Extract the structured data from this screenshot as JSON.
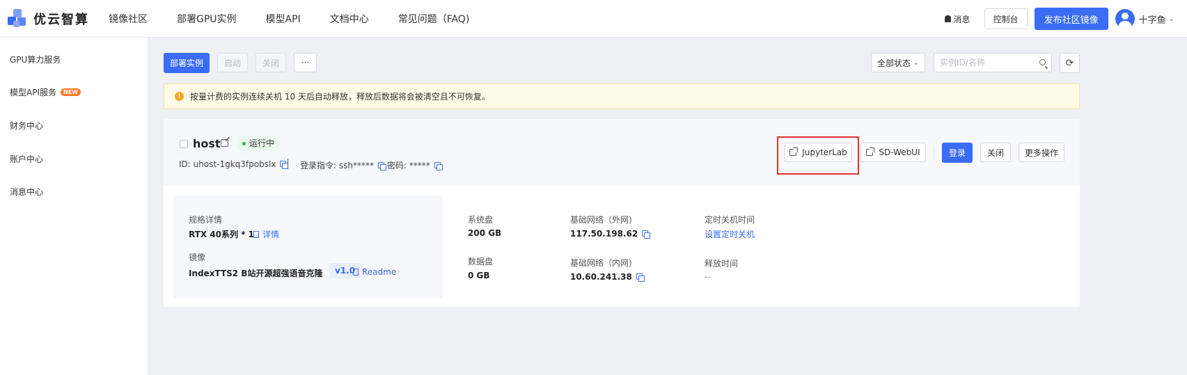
{
  "brand": {
    "name": "优云智算"
  },
  "nav": [
    "镜像社区",
    "部署GPU实例",
    "模型API",
    "文档中心",
    "常见问题（FAQ)"
  ],
  "header": {
    "messages": "消息",
    "console": "控制台",
    "publish": "发布社区镜像",
    "username": "十字鱼"
  },
  "sidebar": {
    "items": [
      {
        "label": "GPU算力服务"
      },
      {
        "label": "模型API服务",
        "badge": "NEW"
      },
      {
        "label": "财务中心"
      },
      {
        "label": "账户中心"
      },
      {
        "label": "消息中心"
      }
    ]
  },
  "toolbar": {
    "deploy": "部署实例",
    "start": "启动",
    "stop": "关闭",
    "more": "···",
    "status_filter": "全部状态",
    "search_placeholder": "实例ID/名称"
  },
  "notice": {
    "text": "按量计费的实例连续关机 10 天后自动释放，释放后数据将会被清空且不可恢复。"
  },
  "instance": {
    "name": "host",
    "status": "运行中",
    "id_text": "ID: uhost-1gkq3fpobslx",
    "login_cmd": "登录指令: ssh*****",
    "password": "密码: *****",
    "actions": {
      "jupyter": "JupyterLab",
      "sdwebui": "SD-WebUI",
      "login": "登录",
      "close": "关闭",
      "more": "更多操作"
    },
    "spec": {
      "label": "规格详情",
      "value": "RTX 40系列 * 1",
      "detail_link": "详情",
      "image_label": "镜像",
      "image_value": "IndexTTS2 B站开源超强语音克隆",
      "version": "v1.0",
      "readme": "Readme"
    },
    "system_disk": {
      "label": "系统盘",
      "value": "200 GB"
    },
    "data_disk": {
      "label": "数据盘",
      "value": "0 GB"
    },
    "net_external": {
      "label": "基础网络（外网)",
      "value": "117.50.198.62"
    },
    "net_internal": {
      "label": "基础网络（内网)",
      "value": "10.60.241.38"
    },
    "shutdown": {
      "label": "定时关机时间",
      "value": "设置定时关机"
    },
    "release": {
      "label": "释放时间",
      "value": "--"
    }
  }
}
